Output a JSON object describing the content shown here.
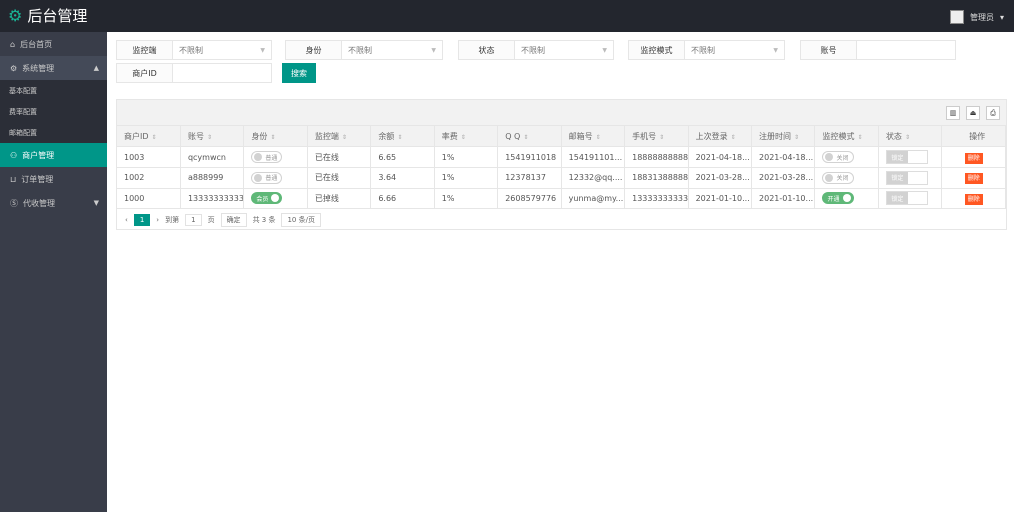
{
  "header": {
    "title": "后台管理",
    "user": "管理员"
  },
  "sidebar": {
    "items": [
      {
        "label": "后台首页",
        "icon": "home-icon"
      },
      {
        "label": "系统管理",
        "icon": "gear-icon",
        "expanded": true
      },
      {
        "label": "基本配置",
        "sub": true
      },
      {
        "label": "费率配置",
        "sub": true
      },
      {
        "label": "邮箱配置",
        "sub": true
      },
      {
        "label": "商户管理",
        "icon": "user-icon",
        "active": true
      },
      {
        "label": "订单管理",
        "icon": "cart-icon"
      },
      {
        "label": "代收管理",
        "icon": "dollar-icon"
      }
    ]
  },
  "filters": {
    "f1": {
      "label": "监控端",
      "value": "不限制"
    },
    "f2": {
      "label": "身份",
      "value": "不限制"
    },
    "f3": {
      "label": "状态",
      "value": "不限制"
    },
    "f4": {
      "label": "监控模式",
      "value": "不限制"
    },
    "f5": {
      "label": "账号",
      "value": ""
    },
    "f6": {
      "label": "商户ID",
      "value": ""
    },
    "search": "搜索"
  },
  "table": {
    "columns": [
      "商户ID",
      "账号",
      "身份",
      "监控端",
      "余额",
      "率费",
      "Q Q",
      "邮箱号",
      "手机号",
      "上次登录",
      "注册时间",
      "监控模式",
      "状态",
      "操作"
    ],
    "rows": [
      {
        "id": "1003",
        "account": "qcymwcn",
        "role": "普通",
        "role_on": false,
        "client": "已在线",
        "balance": "6.65",
        "rate": "1%",
        "qq": "1541911018",
        "email": "154191101...",
        "phone": "18888888888",
        "last": "2021-04-18...",
        "reg": "2021-04-18...",
        "mode": "关闭",
        "mode_on": false,
        "status": "锁定",
        "op": "删除"
      },
      {
        "id": "1002",
        "account": "a888999",
        "role": "普通",
        "role_on": false,
        "client": "已在线",
        "balance": "3.64",
        "rate": "1%",
        "qq": "12378137",
        "email": "12332@qq....",
        "phone": "18831388888",
        "last": "2021-03-28...",
        "reg": "2021-03-28...",
        "mode": "关闭",
        "mode_on": false,
        "status": "锁定",
        "op": "删除"
      },
      {
        "id": "1000",
        "account": "13333333333",
        "role": "会员",
        "role_on": true,
        "client": "已掉线",
        "balance": "6.66",
        "rate": "1%",
        "qq": "2608579776",
        "email": "yunma@my...",
        "phone": "13333333333",
        "last": "2021-01-10...",
        "reg": "2021-01-10...",
        "mode": "开通",
        "mode_on": true,
        "status": "锁定",
        "op": "删除"
      }
    ]
  },
  "pager": {
    "current": "1",
    "goto_label": "到第",
    "page_input": "1",
    "page_unit": "页",
    "confirm": "确定",
    "total": "共 3 条",
    "page_size": "10 条/页"
  },
  "colors": {
    "accent": "#009688",
    "header": "#23262e",
    "sidebar": "#393d49",
    "danger": "#ff5722"
  }
}
